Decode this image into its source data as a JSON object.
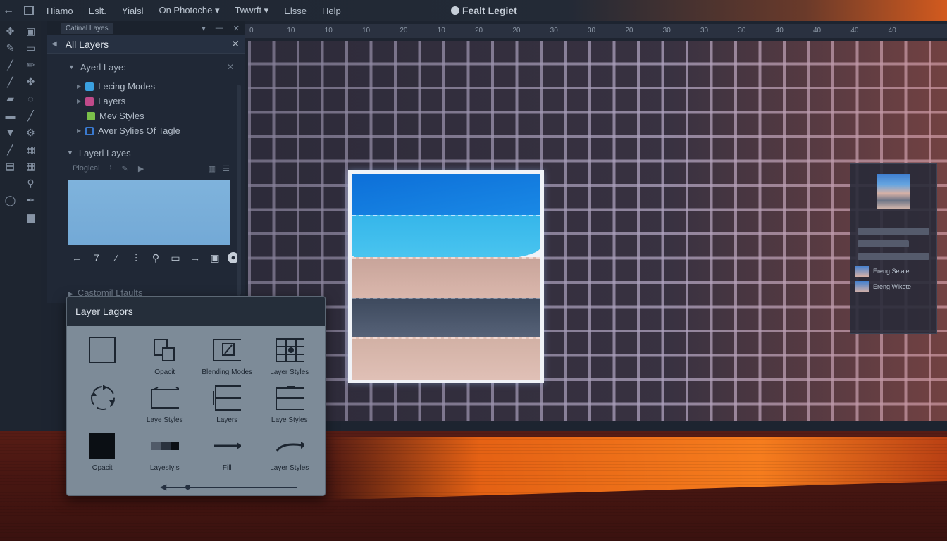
{
  "menubar": {
    "items": [
      "Hiamo",
      "Eslt.",
      "Yialsl",
      "On Photoche ▾",
      "Twwrft ▾",
      "Elsse",
      "Help"
    ],
    "app_title": "Fealt Legiet"
  },
  "layers_panel": {
    "tab_label": "Catinal Layes",
    "header_title": "All Layers",
    "sections": [
      {
        "title": "Ayerl Laye:",
        "items": [
          {
            "label": "Lecing Modes",
            "color": "#3aa0e0"
          },
          {
            "label": "Layers",
            "color": "#c04a8a"
          },
          {
            "label": "Mev Styles",
            "color": "#7ac04a"
          },
          {
            "label": "Aver Sylies Of Tagle",
            "color": "#3a7ad0"
          }
        ]
      }
    ],
    "second_section_title": "Layerl Layes",
    "mini_toolbar_label": "Plogical",
    "faded_section": "Castomil Lfaults"
  },
  "canvas": {
    "ruler_ticks": [
      "0",
      "10",
      "10",
      "10",
      "20",
      "10",
      "20",
      "20",
      "30",
      "30",
      "20",
      "30",
      "30",
      "30",
      "40",
      "40",
      "40",
      "40"
    ]
  },
  "right_dock": {
    "layers": [
      "Ereng Selale",
      "Ereng Wlkete"
    ]
  },
  "float_panel": {
    "title": "Layer Lagors",
    "cells": [
      {
        "label": "",
        "icon": "square-outline-icon"
      },
      {
        "label": "Opacit",
        "icon": "duplicate-icon"
      },
      {
        "label": "Blending Modes",
        "icon": "pencil-box-icon"
      },
      {
        "label": "Layer Styles",
        "icon": "grid-dot-icon"
      },
      {
        "label": "",
        "icon": "rotate-cycle-icon"
      },
      {
        "label": "Laye Styles",
        "icon": "folder-icon"
      },
      {
        "label": "Layers",
        "icon": "stacked-box-icon"
      },
      {
        "label": "Laye Styles",
        "icon": "split-box-icon"
      },
      {
        "label": "Opacit",
        "icon": "filled-square-icon"
      },
      {
        "label": "LayesIyls",
        "icon": "gradient-bar-icon"
      },
      {
        "label": "Fill",
        "icon": "arrow-right-icon"
      },
      {
        "label": "Layer Styles",
        "icon": "curved-arrow-icon"
      }
    ]
  }
}
